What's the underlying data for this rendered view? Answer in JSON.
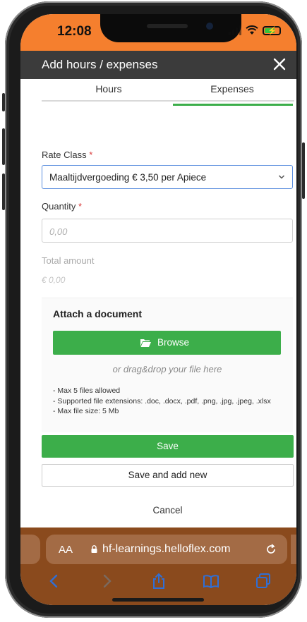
{
  "status": {
    "time": "12:08"
  },
  "modal": {
    "title": "Add hours / expenses",
    "tabs": [
      {
        "label": "Hours"
      },
      {
        "label": "Expenses"
      }
    ],
    "active_tab": "Expenses"
  },
  "form": {
    "rate_class": {
      "label": "Rate Class",
      "required_mark": "*",
      "value": "Maaltijdvergoeding € 3,50 per Apiece"
    },
    "quantity": {
      "label": "Quantity",
      "required_mark": "*",
      "placeholder": "0,00"
    },
    "total": {
      "label": "Total amount",
      "value": "€ 0,00"
    }
  },
  "attach": {
    "title": "Attach a document",
    "browse_label": "Browse",
    "drag_text": "or drag&drop your file here",
    "notes": [
      "- Max 5 files allowed",
      "- Supported file extensions: .doc, .docx, .pdf, .png, .jpg, .jpeg, .xlsx",
      "- Max file size: 5 Mb"
    ]
  },
  "actions": {
    "save": "Save",
    "save_new": "Save and add new",
    "cancel": "Cancel"
  },
  "browser": {
    "text_size": "AA",
    "url": "hf-learnings.helloflex.com"
  },
  "icons": {
    "close": "close-icon",
    "chevron": "chevron-down-icon",
    "folder": "folder-icon",
    "lock": "lock-icon",
    "reload": "reload-icon",
    "back": "back-icon",
    "forward": "forward-icon",
    "share": "share-icon",
    "bookmarks": "book-icon",
    "tabs": "tabs-icon"
  },
  "colors": {
    "status_bar": "#f57f2e",
    "header": "#3b3b3b",
    "accent_green": "#3cae4a",
    "browser_bar": "#8a4a1d"
  }
}
